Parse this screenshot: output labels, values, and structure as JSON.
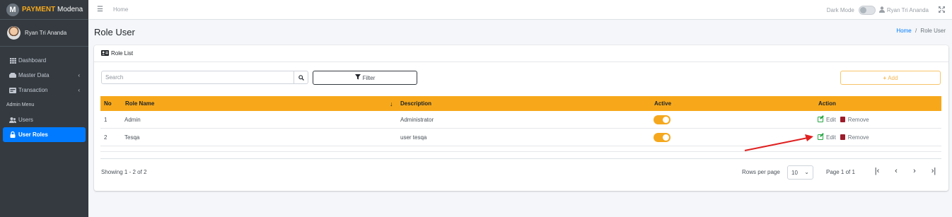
{
  "brand": {
    "logo_letter": "M",
    "bold": "PAYMENT",
    "name": "Modena"
  },
  "user": {
    "name": "Ryan Tri Ananda"
  },
  "sidebar": {
    "items": [
      {
        "label": "Dashboard",
        "icon": "grid-icon"
      },
      {
        "label": "Master Data",
        "icon": "database-icon"
      },
      {
        "label": "Transaction",
        "icon": "card-icon"
      }
    ],
    "admin_header": "Admin Menu",
    "admin_items": [
      {
        "label": "Users",
        "icon": "users-icon"
      },
      {
        "label": "User Roles",
        "icon": "lock-icon",
        "active": true
      }
    ]
  },
  "topbar": {
    "home": "Home",
    "dark_mode_label": "Dark Mode",
    "user_name": "Ryan Tri Ananda"
  },
  "page": {
    "title": "Role User",
    "breadcrumb_home": "Home",
    "breadcrumb_sep": "/",
    "breadcrumb_current": "Role User"
  },
  "card": {
    "title": "Role List",
    "search_placeholder": "Search",
    "filter_label": "Filter",
    "add_label": "Add"
  },
  "table": {
    "headers": {
      "no": "No",
      "role_name": "Role Name",
      "description": "Description",
      "active": "Active",
      "action": "Action"
    },
    "rows": [
      {
        "no": "1",
        "role_name": "Admin",
        "description": "Administrator",
        "active": true,
        "edit": "Edit",
        "remove": "Remove"
      },
      {
        "no": "2",
        "role_name": "Tesqa",
        "description": "user tesqa",
        "active": true,
        "edit": "Edit",
        "remove": "Remove"
      }
    ]
  },
  "footer": {
    "showing": "Showing 1 - 2 of 2",
    "rows_per_page_label": "Rows per page",
    "rows_per_page_value": "10",
    "page_info": "Page 1 of 1"
  },
  "colors": {
    "accent": "#f7a81a",
    "sidebar_bg": "#343a40",
    "active_blue": "#007bff",
    "annotation": "#e02020"
  }
}
